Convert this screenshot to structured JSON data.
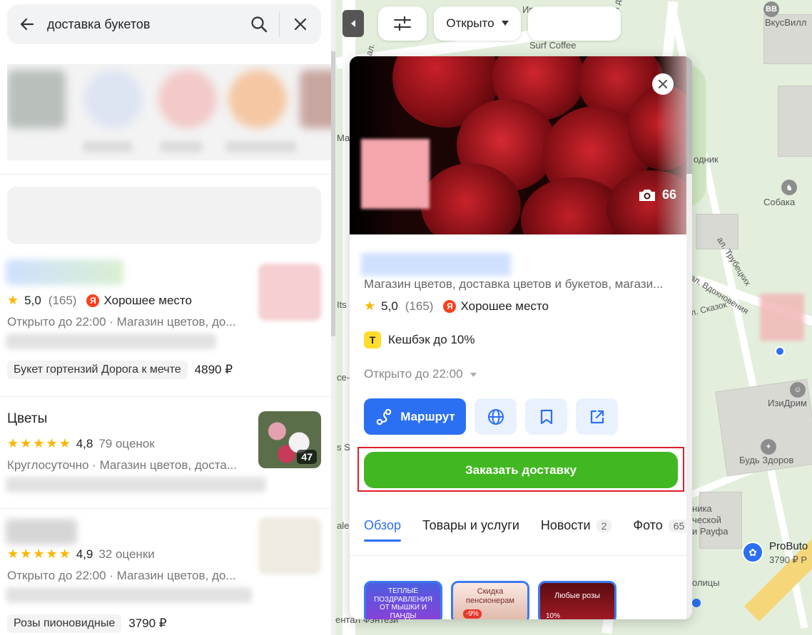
{
  "search": {
    "query": "доставка букетов"
  },
  "results": [
    {
      "rating": "5,0",
      "reviews": "(165)",
      "badge": "Хорошее место",
      "status": "Открыто до 22:00",
      "category": "Магазин цветов, до...",
      "product": "Букет гортензий Дорога к мечте",
      "price": "4890 ₽"
    },
    {
      "title": "Цветы",
      "rating": "4,8",
      "reviews": "79 оценок",
      "status": "Круглосуточно",
      "category": "Магазин цветов, доста...",
      "photo_count": "47"
    },
    {
      "rating": "4,9",
      "reviews": "32 оценки",
      "status": "Открыто до 22:00",
      "category": "Магазин цветов, до...",
      "product": "Розы пионовидные",
      "price": "3790 ₽"
    }
  ],
  "map_controls": {
    "filter_open": "Открыто"
  },
  "org": {
    "photo_count": "66",
    "category": "Магазин цветов, доставка цветов и букетов, магази...",
    "rating": "5,0",
    "reviews": "(165)",
    "badge": "Хорошее место",
    "cashback": "Кешбэк до 10%",
    "hours": "Открыто до 22:00",
    "route_label": "Маршрут",
    "order_label": "Заказать доставку",
    "tabs": [
      {
        "label": "Обзор"
      },
      {
        "label": "Товары и услуги"
      },
      {
        "label": "Новости",
        "count": "2"
      },
      {
        "label": "Фото",
        "count": "65"
      }
    ],
    "promos": [
      {
        "text": "ТЕПЛЫЕ ПОЗДРАВЛЕНИЯ ОТ МЫШКИ И ПАНДЫ"
      },
      {
        "text": "Скидка пенсионерам",
        "extra": "-9%"
      },
      {
        "text": "Любые розы",
        "extra": "10%"
      }
    ]
  },
  "map_labels": {
    "ippodrom": "Ипподром",
    "vkusvill": "ВкусВилл",
    "surf_coffee": "Surf Coffee",
    "vodnik": "одник",
    "sobaka": "Собака",
    "street_trubetskikh": "ал. Трубецких",
    "street_vdokhnoveniya": "ал. Вдохновения",
    "street_skazok": "ал. Сказок",
    "izidream": "ИзиДрим",
    "bud_zdorov": "Будь Здоров",
    "clinic_1": "ника",
    "clinic_2": "ческой",
    "clinic_3": "и Рауфа",
    "probuto_name": "ProButo",
    "probuto_price": "3790 ₽ Р",
    "bottom_1": "олицы",
    "bottom_2": "ентал Фэнтези",
    "left_1": "ал.",
    "left_2": "Its",
    "left_3": "ce-c",
    "left_4": "s Sp",
    "left_5": "ale",
    "left_6": "Ма",
    "road": "лавная доро"
  },
  "colors": {
    "accent_blue": "#2b70f2",
    "order_green": "#41b821",
    "highlight_red": "#e01e2d",
    "star": "#fcb600",
    "yandex_red": "#fc3f1d"
  }
}
